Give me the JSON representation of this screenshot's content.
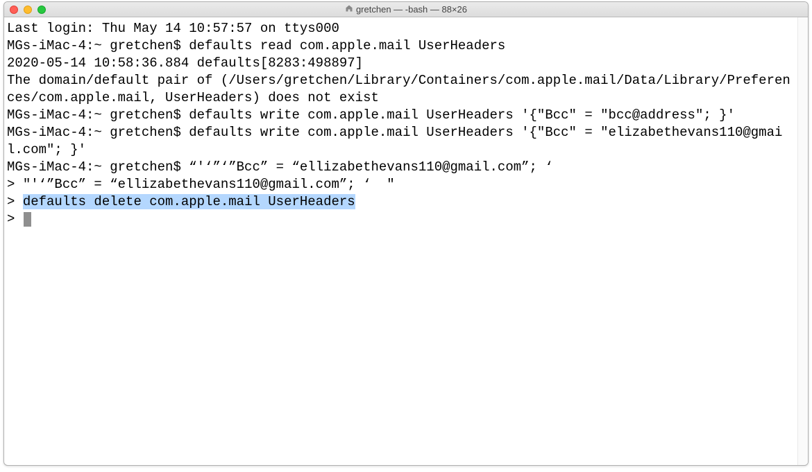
{
  "window": {
    "title": "gretchen — -bash — 88×26"
  },
  "terminal": {
    "line1": "Last login: Thu May 14 10:57:57 on ttys000",
    "line2": "MGs-iMac-4:~ gretchen$ defaults read com.apple.mail UserHeaders",
    "line3": "2020-05-14 10:58:36.884 defaults[8283:498897]",
    "line4": "The domain/default pair of (/Users/gretchen/Library/Containers/com.apple.mail/Data/Library/Preferences/com.apple.mail, UserHeaders) does not exist",
    "line5": "MGs-iMac-4:~ gretchen$ defaults write com.apple.mail UserHeaders '{\"Bcc\" = \"bcc@address\"; }'",
    "line6": "MGs-iMac-4:~ gretchen$ defaults write com.apple.mail UserHeaders '{\"Bcc\" = \"elizabethevans110@gmail.com\"; }'",
    "line7": "MGs-iMac-4:~ gretchen$ “'‘”‘”Bcc” = “ellizabethevans110@gmail.com”; ‘",
    "line8_prefix": "> ",
    "line8": "\"'‘”Bcc” = “ellizabethevans110@gmail.com”; ‘  \"",
    "line9_prefix": "> ",
    "line9_selected": "defaults delete com.apple.mail UserHeaders",
    "line10_prefix": "> "
  }
}
